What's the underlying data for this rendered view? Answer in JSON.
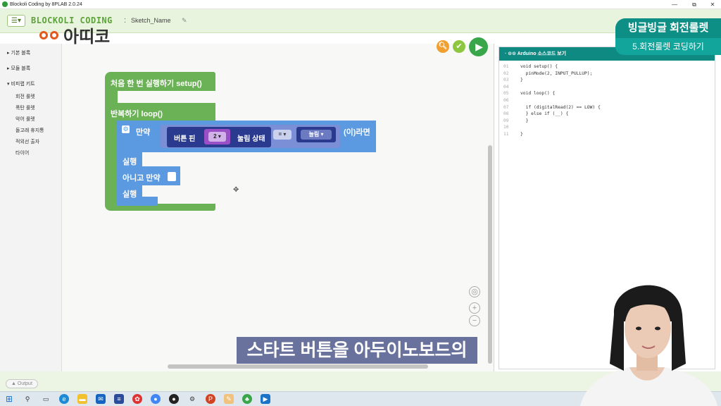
{
  "window": {
    "title": "Blockoli Coding by 8PLAB 2.0.24",
    "minimize": "—",
    "restore": "⧉",
    "close": "✕"
  },
  "appbar": {
    "menu_icon": "☰▾",
    "brand": "BLOCKOLI CODING",
    "separator": ":",
    "sketch_name": "Sketch_Name",
    "edit_icon": "✎"
  },
  "watermark": {
    "text": "아띠코"
  },
  "sidebar": {
    "groups": [
      {
        "label": "기본 블록"
      },
      {
        "label": "모듈 블록"
      },
      {
        "label": "비피랩 키트"
      }
    ],
    "kit_items": [
      {
        "label": "회전 룰렛"
      },
      {
        "label": "폭탄 룰렛"
      },
      {
        "label": "악어 룰렛"
      },
      {
        "label": "돌고래 휴지통"
      },
      {
        "label": "적외선 출자"
      },
      {
        "label": "타이어"
      }
    ]
  },
  "blocks": {
    "setup_label": "처음 한 번 실행하기 setup()",
    "loop_label": "반복하기 loop()",
    "if_label": "만약",
    "button_pin_label": "버튼 핀",
    "pin_value": "2 ▾",
    "press_state_label": "눌림 상태",
    "operator": "= ▾",
    "state_value": "눌림 ▾",
    "then_label": "(이)라면",
    "do_label_1": "실행",
    "else_if_label": "아니고 만약",
    "do_label_2": "실행"
  },
  "code": {
    "header": "Arduino 소스코드 보기",
    "lines": [
      {
        "n": "01",
        "t": "void setup() {"
      },
      {
        "n": "02",
        "t": "  pinMode(2, INPUT_PULLUP);"
      },
      {
        "n": "03",
        "t": "}"
      },
      {
        "n": "04",
        "t": ""
      },
      {
        "n": "05",
        "t": "void loop() {"
      },
      {
        "n": "06",
        "t": ""
      },
      {
        "n": "07",
        "t": "  if (digitalRead(2) == LOW) {"
      },
      {
        "n": "08",
        "t": "  } else if (__) {"
      },
      {
        "n": "09",
        "t": "  }"
      },
      {
        "n": "10",
        "t": ""
      },
      {
        "n": "11",
        "t": "}"
      }
    ]
  },
  "overlay": {
    "title": "빙글빙글 회전룰렛",
    "subtitle": "5.회전룰렛 코딩하기"
  },
  "caption": "스타트 버튼을 아두이노보드의",
  "output_button": "▲ Output",
  "colors": {
    "loop_green": "#6bb257",
    "if_blue": "#5b9ae0",
    "sensor_navy": "#2a3a8f",
    "pin_purple": "#9b4fc6",
    "teal": "#0e8a83"
  }
}
